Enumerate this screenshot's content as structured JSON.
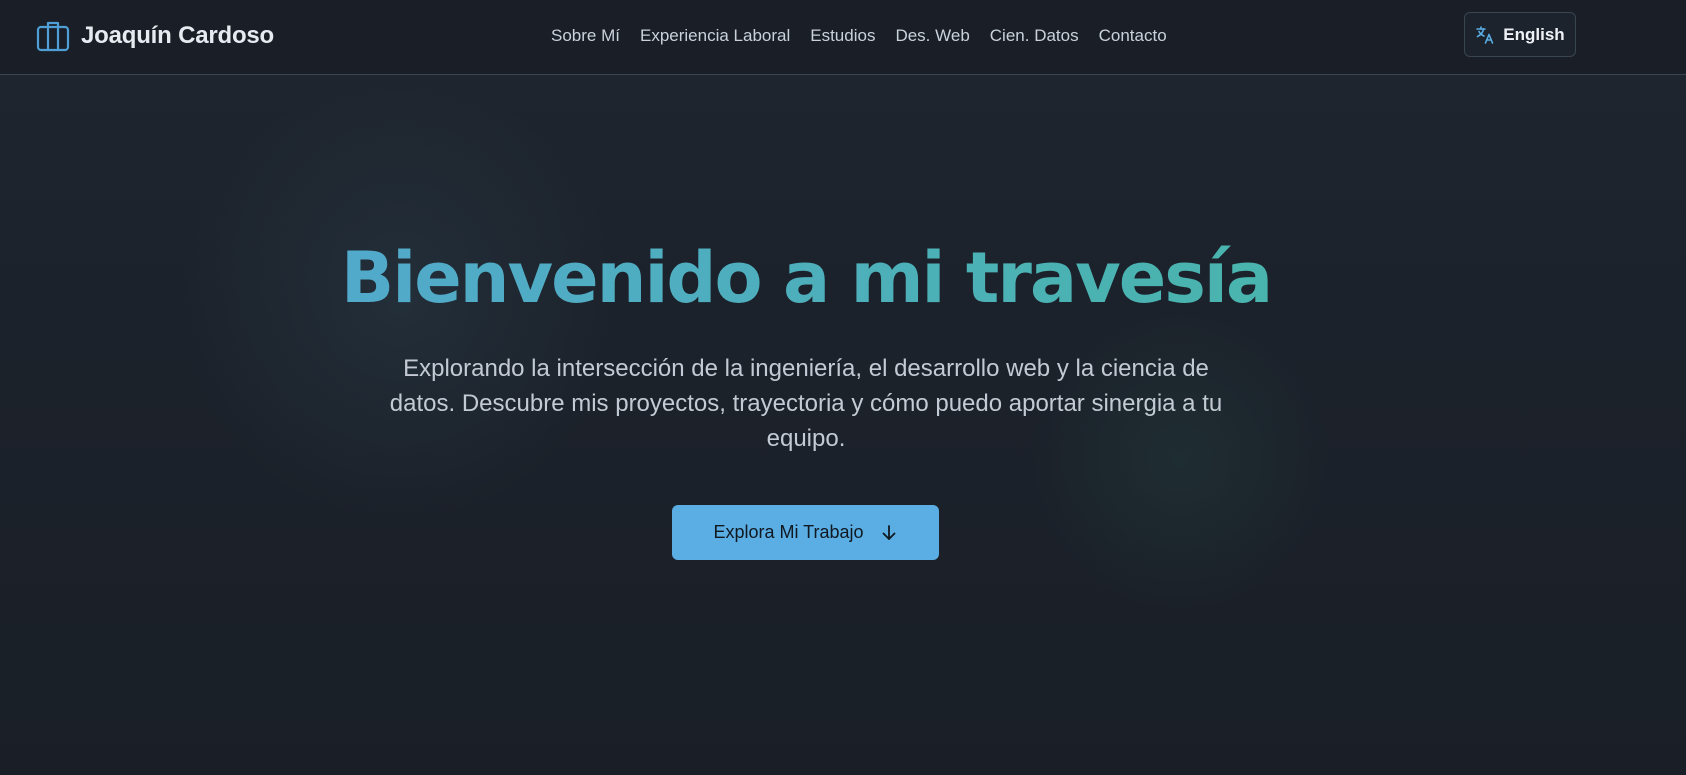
{
  "header": {
    "brand": {
      "name": "Joaquín Cardoso",
      "icon": "briefcase-icon"
    },
    "nav": [
      {
        "label": "Sobre Mí"
      },
      {
        "label": "Experiencia Laboral"
      },
      {
        "label": "Estudios"
      },
      {
        "label": "Des. Web"
      },
      {
        "label": "Cien. Datos"
      },
      {
        "label": "Contacto"
      }
    ],
    "language_button": {
      "label": "English",
      "icon": "translate-icon"
    }
  },
  "hero": {
    "title": "Bienvenido a mi travesía",
    "subtitle": "Explorando la intersección de la ingeniería, el desarrollo web y la ciencia de datos. Descubre mis proyectos, trayectoria y cómo puedo aportar sinergia a tu equipo.",
    "cta": {
      "label": "Explora Mi Trabajo",
      "icon": "arrow-down-icon"
    }
  },
  "colors": {
    "background": "#1a1f27",
    "accent": "#5aaee4",
    "gradient_start": "#55a6d6",
    "gradient_end": "#46b7a3"
  }
}
